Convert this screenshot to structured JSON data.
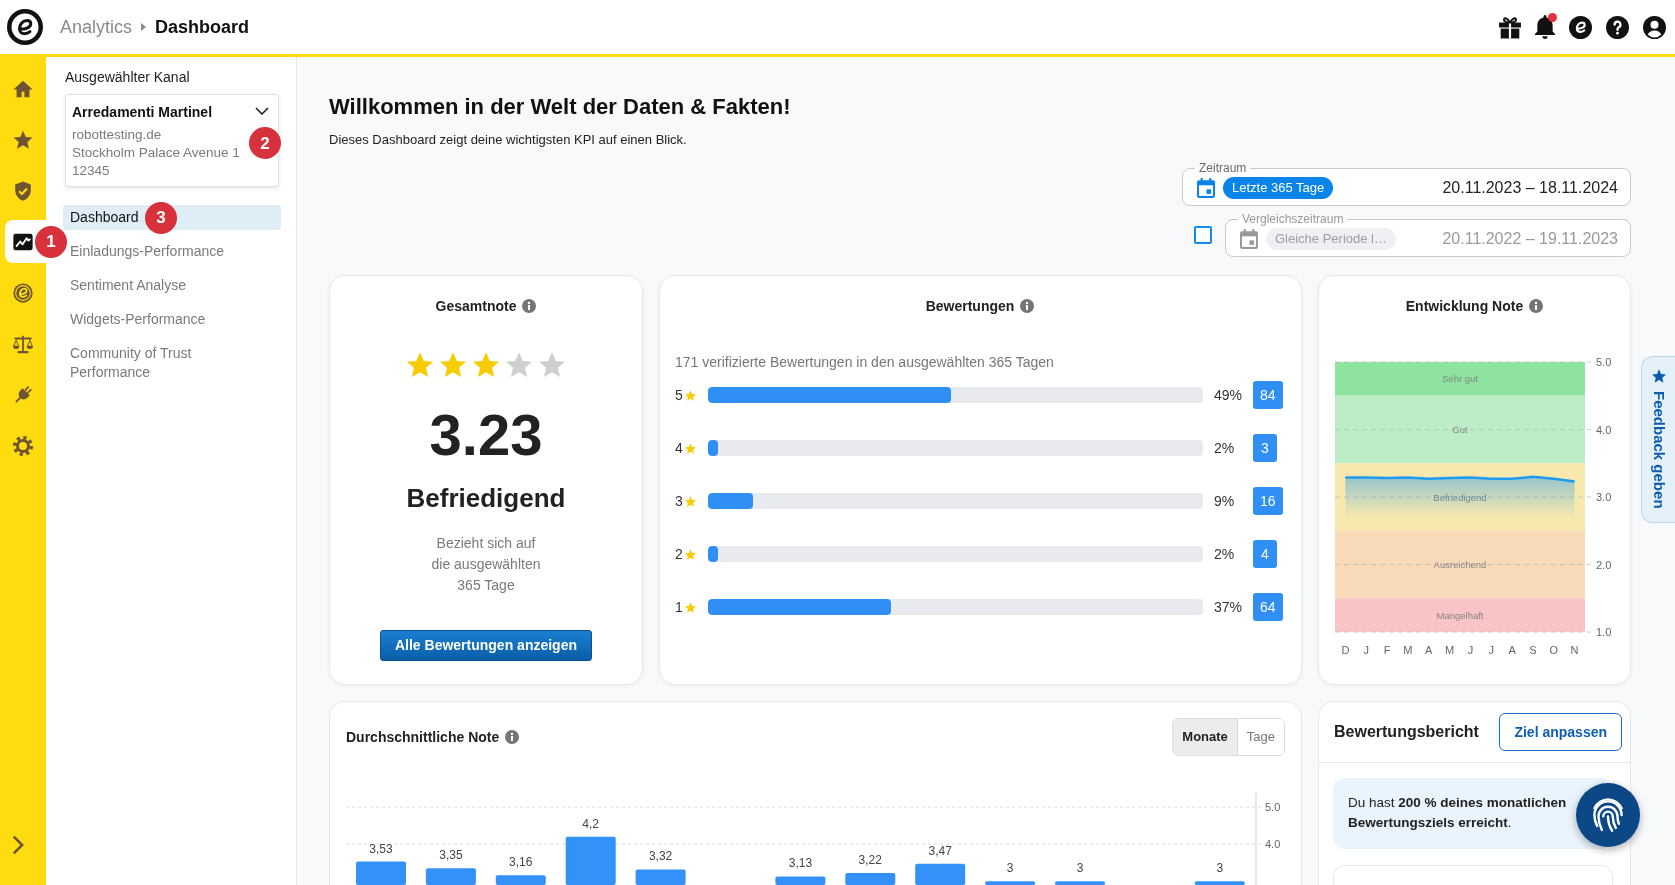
{
  "header": {
    "breadcrumb": [
      {
        "label": "Analytics",
        "current": false
      },
      {
        "label": "Dashboard",
        "current": true
      }
    ],
    "notification_dot": true
  },
  "rail": {
    "items": [
      {
        "selected": false
      },
      {
        "selected": false
      },
      {
        "selected": false
      },
      {
        "selected": true,
        "marker": "1"
      },
      {
        "selected": false
      },
      {
        "selected": false
      },
      {
        "selected": false
      },
      {
        "selected": false
      }
    ]
  },
  "sidebar": {
    "channel_label": "Ausgewählter Kanal",
    "channel": {
      "name": "Arredamenti Martinel",
      "lines": [
        "robottesting.de",
        "Stockholm Palace Avenue 1",
        "12345"
      ],
      "marker": "2"
    },
    "nav": [
      {
        "label": "Dashboard",
        "selected": true,
        "marker": "3"
      },
      {
        "label": "Einladungs-Performance",
        "selected": false
      },
      {
        "label": "Sentiment Analyse",
        "selected": false
      },
      {
        "label": "Widgets-Performance",
        "selected": false
      },
      {
        "label": "Community of Trust Performance",
        "selected": false
      }
    ]
  },
  "page": {
    "title": "Willkommen in der Welt der Daten & Fakten!",
    "subtitle": "Dieses Dashboard zeigt deine wichtigsten KPI auf einen Blick."
  },
  "period": {
    "label": "Zeitraum",
    "chip": "Letzte 365 Tage",
    "range": "20.11.2023 – 18.11.2024",
    "disabled": false
  },
  "comparison": {
    "checked": false,
    "label": "Vergleichszeitraum",
    "chip": "Gleiche Periode l…",
    "range": "20.11.2022 – 19.11.2023",
    "disabled": true
  },
  "overall": {
    "title": "Gesamtnote",
    "stars": 3,
    "score": "3.23",
    "grade": "Befriedigend",
    "note": "Bezieht sich auf die ausgewählten 365 Tage",
    "button": "Alle Bewertungen anzeigen"
  },
  "ratings": {
    "title": "Bewertungen",
    "summary": "171 verifizierte Bewertungen in den ausgewählten 365 Tagen",
    "rows": [
      {
        "label": "5",
        "level": 0.49,
        "percent": "49%",
        "count": "84"
      },
      {
        "label": "4",
        "level": 0.02,
        "percent": "2%",
        "count": "3"
      },
      {
        "label": "3",
        "level": 0.09,
        "percent": "9%",
        "count": "16"
      },
      {
        "label": "2",
        "level": 0.02,
        "percent": "2%",
        "count": "4"
      },
      {
        "label": "1",
        "level": 0.37,
        "percent": "37%",
        "count": "64"
      }
    ]
  },
  "trend": {
    "title": "Entwicklung Note",
    "chart_data": {
      "type": "area",
      "categories": [
        "D",
        "J",
        "F",
        "M",
        "A",
        "M",
        "J",
        "J",
        "A",
        "S",
        "O",
        "N"
      ],
      "series": [
        {
          "color": "#1e9bf0",
          "values": [
            3.29,
            3.29,
            3.28,
            3.29,
            3.27,
            3.28,
            3.29,
            3.27,
            3.27,
            3.3,
            3.27,
            3.23
          ]
        }
      ],
      "ylim": [
        1,
        5
      ],
      "yticks": [
        {
          "value": 5,
          "label": "5.0"
        },
        {
          "value": 4,
          "label": "4.0"
        },
        {
          "value": 3,
          "label": "3.0"
        },
        {
          "value": 2,
          "label": "2.0"
        },
        {
          "value": 1,
          "label": "1.0"
        }
      ],
      "grid": true,
      "bands": [
        {
          "axis": "y",
          "label": "Sehr gut",
          "from": 4.5,
          "to": 5,
          "color": "#8fe3a0"
        },
        {
          "axis": "y",
          "label": "Gut",
          "from": 3.5,
          "to": 4.5,
          "color": "#bbeec6"
        },
        {
          "axis": "y",
          "label": "Befriedigend",
          "from": 2.5,
          "to": 3.5,
          "color": "#f7e8ae"
        },
        {
          "axis": "y",
          "label": "Ausreichend",
          "from": 1.5,
          "to": 2.5,
          "color": "#f9dab8"
        },
        {
          "axis": "y",
          "label": "Mangelhaft",
          "from": 1,
          "to": 1.5,
          "color": "#f9c4c6"
        }
      ]
    }
  },
  "average": {
    "title": "Durchschnittliche Note",
    "toggle": [
      {
        "label": "Monate",
        "selected": true
      },
      {
        "label": "Tage",
        "selected": false
      }
    ],
    "chart_data": {
      "type": "bar",
      "series": [
        {
          "color": "#3391f7",
          "values": [
            3.53,
            3.35,
            3.16,
            4.2,
            3.32,
            null,
            3.13,
            3.22,
            3.47,
            3,
            3,
            null,
            3
          ]
        }
      ],
      "value_labels": [
        "3,53",
        "3,35",
        "3,16",
        "4,2",
        "3,32",
        null,
        "3,13",
        "3,22",
        "3,47",
        "3",
        "3",
        null,
        "3"
      ],
      "ylim": [
        2.9,
        5
      ],
      "yticks": [
        {
          "value": 5,
          "label": "5.0"
        },
        {
          "value": 4,
          "label": "4.0"
        }
      ],
      "grid": true
    }
  },
  "report": {
    "title": "Bewertungsbericht",
    "button": "Ziel anpassen",
    "message": "Du hast **200 % deines monatlichen Bewertungsziels erreicht**."
  },
  "feedback": {
    "label": "Feedback geben"
  }
}
